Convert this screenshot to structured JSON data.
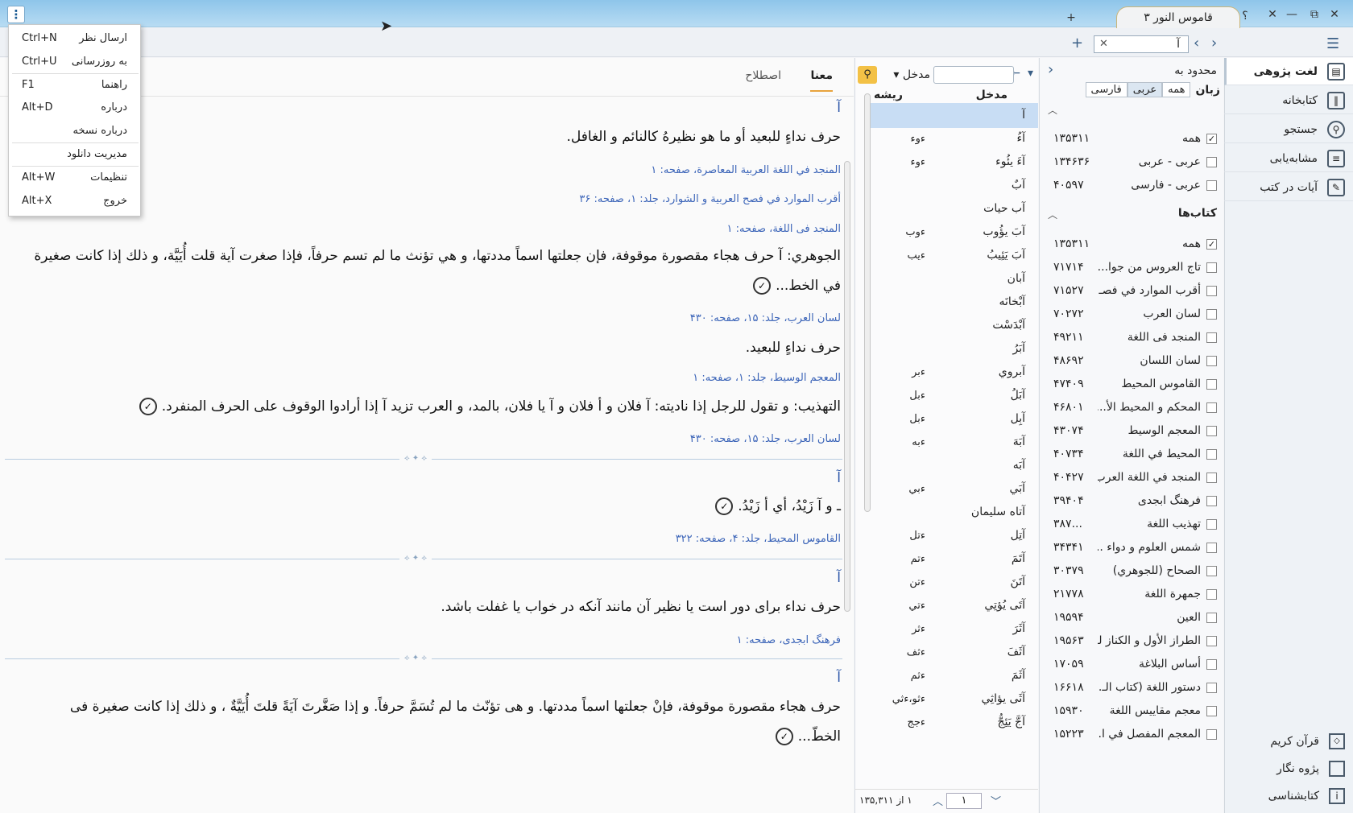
{
  "window": {
    "tab_title": "قاموس النور ۳",
    "new_tab": "+",
    "controls": [
      "؟",
      "✕",
      "—",
      "⧉",
      "✕"
    ]
  },
  "popup_menu": {
    "items": [
      {
        "label": "ارسال نظر",
        "shortcut": "Ctrl+N"
      },
      {
        "label": "به روزرسانی",
        "shortcut": "Ctrl+U"
      },
      {
        "label": "راهنما",
        "shortcut": "F1"
      },
      {
        "label": "درباره",
        "shortcut": "Alt+D"
      },
      {
        "label": "درباره نسخه",
        "shortcut": ""
      },
      {
        "label": "مدیریت دانلود",
        "shortcut": ""
      },
      {
        "label": "تنظیمات",
        "shortcut": "Alt+W"
      },
      {
        "label": "خروج",
        "shortcut": "Alt+X"
      }
    ]
  },
  "toolbar": {
    "search_value": "آ",
    "clear": "✕"
  },
  "sidebar": {
    "items": [
      {
        "label": "لغت پژوهی",
        "icon": "dictionary-icon"
      },
      {
        "label": "کتابخانه",
        "icon": "library-icon"
      },
      {
        "label": "جستجو",
        "icon": "search-icon"
      },
      {
        "label": "مشابه‌یابی",
        "icon": "similar-icon"
      },
      {
        "label": "آیات در کتب",
        "icon": "verses-icon"
      }
    ],
    "bottom": [
      {
        "label": "قرآن کریم",
        "icon": "quran-icon"
      },
      {
        "label": "پژوه نگار",
        "icon": "notes-icon"
      },
      {
        "label": "کتابشناسی",
        "icon": "bibliography-icon"
      }
    ]
  },
  "filter": {
    "header": "محدود به",
    "lang_label": "زبان",
    "lang_options": [
      "همه",
      "عربی",
      "فارسی"
    ],
    "lang_rows": [
      {
        "label": "همه",
        "count": "۱۳۵۳۱۱",
        "checked": true
      },
      {
        "label": "عربی - عربی",
        "count": "۱۳۴۶۳۶",
        "checked": false
      },
      {
        "label": "عربی - فارسی",
        "count": "۴۰۵۹۷",
        "checked": false
      }
    ],
    "books_title": "کتاب‌ها",
    "book_rows": [
      {
        "label": "همه",
        "count": "۱۳۵۳۱۱",
        "checked": true
      },
      {
        "label": "تاج العروس من جوا...",
        "count": "۷۱۷۱۴"
      },
      {
        "label": "أقرب الموارد في فصـ...",
        "count": "۷۱۵۲۷"
      },
      {
        "label": "لسان العرب",
        "count": "۷۰۲۷۲"
      },
      {
        "label": "المنجد فی اللغة",
        "count": "۴۹۲۱۱"
      },
      {
        "label": "لسان اللسان",
        "count": "۴۸۶۹۲"
      },
      {
        "label": "القاموس المحيط",
        "count": "۴۷۴۰۹"
      },
      {
        "label": "المحكم و المحيط الأ...",
        "count": "۴۶۸۰۱"
      },
      {
        "label": "المعجم الوسيط",
        "count": "۴۳۰۷۴"
      },
      {
        "label": "المحيط في اللغة",
        "count": "۴۰۷۳۴"
      },
      {
        "label": "المنجد في اللغة العرب...",
        "count": "۴۰۴۲۷"
      },
      {
        "label": "فرهنگ ابجدی",
        "count": "۳۹۴۰۴"
      },
      {
        "label": "تهذيب اللغة",
        "count": "...۳۸۷"
      },
      {
        "label": "شمس العلوم و دواء ...",
        "count": "۳۴۳۴۱"
      },
      {
        "label": "الصحاح (للجوهري)",
        "count": "۳۰۳۷۹"
      },
      {
        "label": "جمهرة اللغة",
        "count": "۲۱۷۷۸"
      },
      {
        "label": "العين",
        "count": "۱۹۵۹۴"
      },
      {
        "label": "الطراز الأول و الكناز لـ...",
        "count": "۱۹۵۶۳"
      },
      {
        "label": "أساس البلاغة",
        "count": "۱۷۰۵۹"
      },
      {
        "label": "دستور اللغة (كتاب الـ...",
        "count": "۱۶۶۱۸"
      },
      {
        "label": "معجم مقاييس اللغة",
        "count": "۱۵۹۳۰"
      },
      {
        "label": "المعجم المفصل في ا...",
        "count": "۱۵۲۲۳"
      }
    ]
  },
  "entries": {
    "mode": "مدخل",
    "col_entry": "مدخل",
    "col_root": "ریشه",
    "rows": [
      {
        "w": "آ",
        "r": "",
        "sel": true
      },
      {
        "w": "آءُ",
        "r": "ءوء"
      },
      {
        "w": "آءَ يئُوء",
        "r": "ءوء"
      },
      {
        "w": "آبٌ",
        "r": ""
      },
      {
        "w": "آب حیات",
        "r": ""
      },
      {
        "w": "آبَ يؤُوب",
        "r": "ءوب"
      },
      {
        "w": "آبَ يَئِيبُ",
        "r": "ءيب"
      },
      {
        "w": "آبان",
        "r": ""
      },
      {
        "w": "آبْخانَه",
        "r": ""
      },
      {
        "w": "آبْدَسْت",
        "r": ""
      },
      {
        "w": "آبَرُ",
        "r": ""
      },
      {
        "w": "آبروي",
        "r": "ءبر"
      },
      {
        "w": "آبَلُ",
        "r": "ءبل"
      },
      {
        "w": "آبِل",
        "r": "ءبل"
      },
      {
        "w": "آبَهَ",
        "r": "ءبه"
      },
      {
        "w": "آبَه",
        "r": ""
      },
      {
        "w": "آبَي",
        "r": "ءبي"
      },
      {
        "w": "آتاه سليمان",
        "r": ""
      },
      {
        "w": "آتِل",
        "r": "ءتل"
      },
      {
        "w": "آتَمَ",
        "r": "ءتم"
      },
      {
        "w": "آتَنَ",
        "r": "ءتن"
      },
      {
        "w": "آتَى يُؤتِي",
        "r": "ءتي"
      },
      {
        "w": "آثَرَ",
        "r": "ءثر"
      },
      {
        "w": "آثَفَ",
        "r": "ءثف"
      },
      {
        "w": "آثَمَ",
        "r": "ءثم"
      },
      {
        "w": "آثَى يؤاثِي",
        "r": "ءثو،ءثي"
      },
      {
        "w": "آجَّ يَئِجُّ",
        "r": "ءجج"
      }
    ],
    "page": "۱",
    "page_total": "۱ از ۱۳۵,۳۱۱"
  },
  "content": {
    "tabs": [
      "معنا",
      "اصطلاح"
    ],
    "lines": [
      {
        "cls": "word",
        "text": "آ"
      },
      {
        "cls": "big",
        "text": "حرف نداءٍ للبعيد أو ما هو نظيرهُ كالنائم و الغافل."
      },
      {
        "cls": "src",
        "text": "المنجد في اللغة العربية المعاصرة، صفحه: ۱"
      },
      {
        "cls": "src",
        "text": "أقرب الموارد في فصح العربية و الشوارد، جلد: ۱، صفحه: ۳۶"
      },
      {
        "cls": "src",
        "text": "المنجد فی اللغة، صفحه: ۱"
      },
      {
        "cls": "big",
        "text": "الجوهري: آ حرف هجاء مقصورة موقوفة، فإن جعلتها اسماً مددتها، و هي تؤنث ما لم تسم حرفاً، فإذا صغرت آية قلت أُيَيَّة، و ذلك إذا كانت صغيرة"
      },
      {
        "cls": "big",
        "text": "في الخط..."
      },
      {
        "cls": "src",
        "text": "لسان العرب، جلد: ۱۵، صفحه: ۴۳۰"
      },
      {
        "cls": "big",
        "text": "حرف نداءٍ للبعيد."
      },
      {
        "cls": "src",
        "text": "المعجم الوسيط، جلد: ۱، صفحه: ۱"
      },
      {
        "cls": "big",
        "text": "التهذيب: و تقول للرجل إذا ناديته: آ فلان و أ فلان و آ يا فلان، بالمد، و العرب تزيد آ إذا أرادوا الوقوف على الحرف المنفرد."
      },
      {
        "cls": "src",
        "text": "لسان العرب، جلد: ۱۵، صفحه: ۴۳۰"
      },
      {
        "cls": "word",
        "text": "آ"
      },
      {
        "cls": "big",
        "text": "ـ و آ زَيْدُ، أي أ زَيْدُ."
      },
      {
        "cls": "src",
        "text": "القاموس المحيط، جلد: ۴، صفحه: ۳۲۲"
      },
      {
        "cls": "word",
        "text": "آ"
      },
      {
        "cls": "big",
        "text": "حرف نداء برای دور است یا نظیر آن مانند آنكه در خواب یا غفلت باشد."
      },
      {
        "cls": "src",
        "text": "فرهنگ ابجدی، صفحه: ۱"
      },
      {
        "cls": "word",
        "text": "آ"
      },
      {
        "cls": "big",
        "text": "حرف هجاء مقصورة موقوفة، فإنْ جعلتها اسماً مددتها. و هی تؤنّث ما لم تُسَمَّ حرفاً. و إذا صَغَّرتَ آيَةً قلتَ أُيَيَّةٌ ، و ذلك إذا كانت صغيرة فی"
      },
      {
        "cls": "big",
        "text": "الخطّ..."
      }
    ]
  }
}
